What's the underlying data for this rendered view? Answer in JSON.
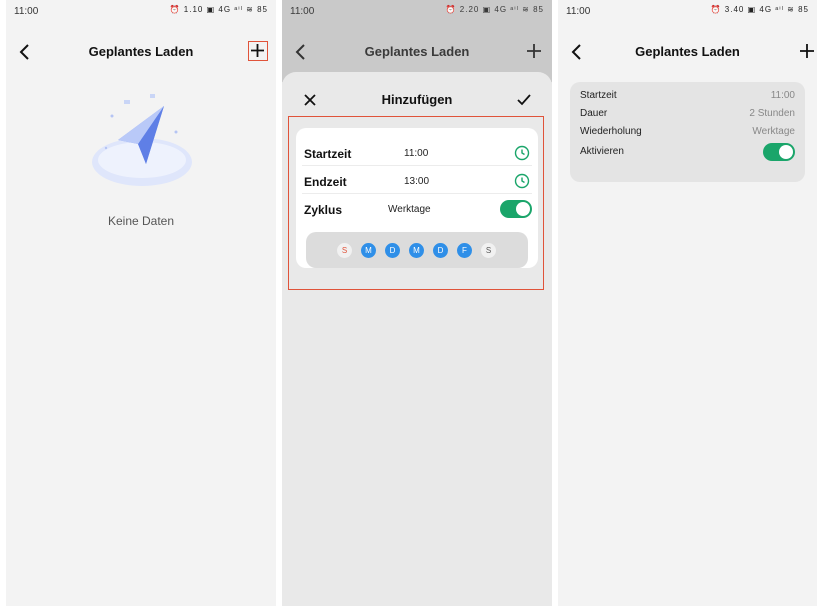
{
  "screens": [
    {
      "status_time": "11:00",
      "status_icons": "⏰ 1.10 ▣ 4G ᵃⁱˡ ≋ 85",
      "title": "Geplantes Laden",
      "empty_text": "Keine Daten"
    },
    {
      "status_time": "11:00",
      "status_icons": "⏰ 2.20 ▣ 4G ᵃⁱˡ ≋ 85",
      "title": "Geplantes Laden",
      "sheet_title": "Hinzufügen",
      "form": {
        "start_label": "Startzeit",
        "start_value": "11:00",
        "end_label": "Endzeit",
        "end_value": "13:00",
        "cycle_label": "Zyklus",
        "cycle_value": "Werktage",
        "cycle_enabled": true,
        "days": [
          {
            "letter": "S",
            "selected": false
          },
          {
            "letter": "M",
            "selected": true
          },
          {
            "letter": "D",
            "selected": true
          },
          {
            "letter": "M",
            "selected": true
          },
          {
            "letter": "D",
            "selected": true
          },
          {
            "letter": "F",
            "selected": true
          },
          {
            "letter": "S",
            "selected": false
          }
        ]
      }
    },
    {
      "status_time": "11:00",
      "status_icons": "⏰ 3.40 ▣ 4G ᵃⁱˡ ≋ 85",
      "title": "Geplantes Laden",
      "schedule": {
        "start_label": "Startzeit",
        "start_value": "11:00",
        "duration_label": "Dauer",
        "duration_value": "2 Stunden",
        "repeat_label": "Wiederholung",
        "repeat_value": "Werktage",
        "activate_label": "Aktivieren",
        "active": true
      }
    }
  ],
  "colors": {
    "accent_green": "#1aa56a",
    "day_blue": "#2f8fe8",
    "highlight_red": "#e0533a"
  },
  "icons": [
    "back-icon",
    "plus-icon",
    "close-icon",
    "check-icon",
    "clock-icon",
    "paper-plane-icon"
  ]
}
